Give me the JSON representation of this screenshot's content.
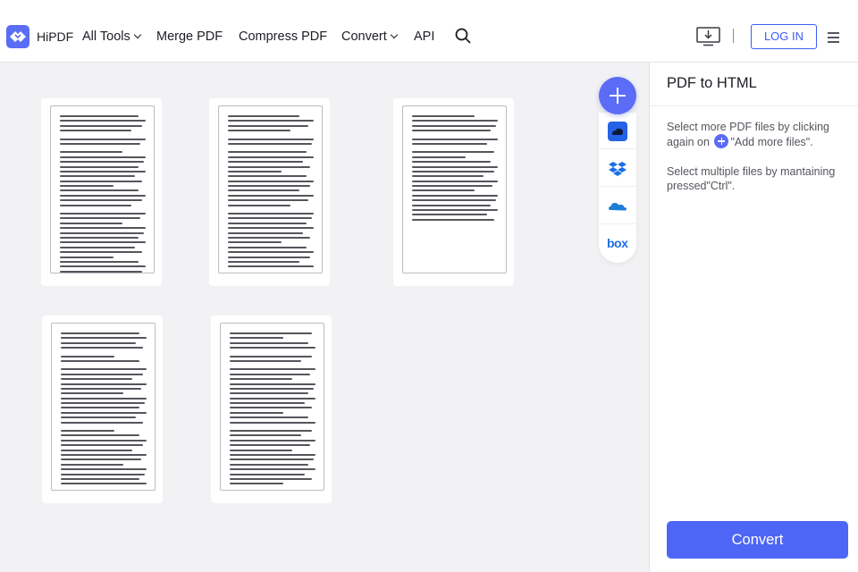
{
  "header": {
    "brand": "HiPDF",
    "nav": {
      "all_tools": "All Tools",
      "merge_pdf": "Merge PDF",
      "compress_pdf": "Compress PDF",
      "convert": "Convert",
      "api": "API"
    },
    "login_label": "LOG IN",
    "icons": [
      "search-icon",
      "desktop-download-icon",
      "hamburger-menu-icon"
    ]
  },
  "toolbar": {
    "add_icon": "plus-icon",
    "cloud_sources": [
      "hipdf-cloud-icon",
      "dropbox-icon",
      "onedrive-icon",
      "box-icon"
    ],
    "box_label": "box"
  },
  "panel": {
    "title": "PDF to HTML",
    "hint1_before": "Select more PDF files by clicking again on",
    "hint1_after": "\"Add more files\".",
    "hint2": "Select multiple files by mantaining pressed\"Ctrl\".",
    "convert_label": "Convert"
  },
  "colors": {
    "accent": "#4e66f5",
    "background": "#f2f2f4",
    "panel": "#ffffff"
  }
}
